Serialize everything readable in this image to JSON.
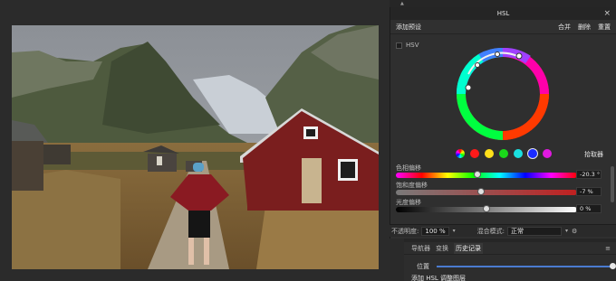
{
  "panel": {
    "title": "HSL",
    "add_preset": "添加预设",
    "merge": "合并",
    "delete": "删除",
    "reset": "重置",
    "hsv_label": "HSV",
    "pick_label": "拾取器"
  },
  "sliders": {
    "hue_label": "色相偏移",
    "hue_value": "-20.3 °",
    "sat_label": "饱和度偏移",
    "sat_value": "-7 %",
    "lum_label": "光度偏移",
    "lum_value": "0 %"
  },
  "opacity": {
    "label": "不透明度:",
    "value": "100 %",
    "blend_label": "混合模式:",
    "blend_value": "正常"
  },
  "lower": {
    "tabs": [
      "导航器",
      "变换",
      "历史记录"
    ],
    "position_label": "位置",
    "history_item": "添加 HSL 调整图层"
  },
  "swatch_colors": [
    "#ff1a1a",
    "#ffe01a",
    "#1ad81a",
    "#1ae0e0",
    "#1a2bff",
    "#e01ae0"
  ],
  "icons": {
    "close": "close-icon",
    "gear": "gear-icon",
    "menu": "menu-icon"
  }
}
